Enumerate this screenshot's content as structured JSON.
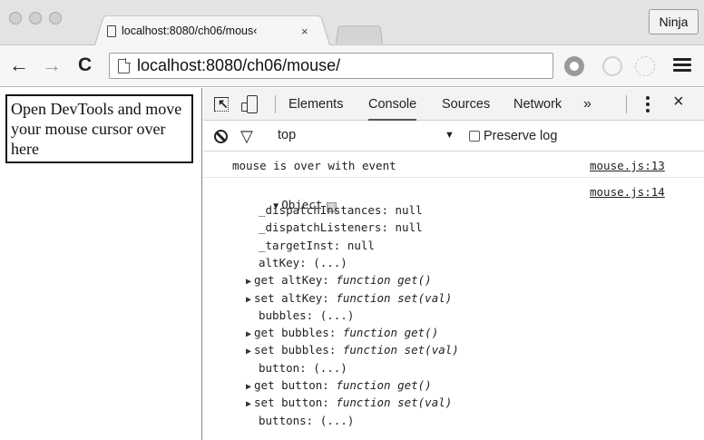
{
  "window": {
    "tab_title": "localhost:8080/ch06/mous‹",
    "tab_close": "×",
    "profile_label": "Ninja"
  },
  "toolbar": {
    "back": "←",
    "forward": "→",
    "reload": "C",
    "url": "localhost:8080/ch06/mouse/",
    "bookmark": "☆"
  },
  "page": {
    "mouse_box_text": "Open DevTools and move your mouse cursor over here"
  },
  "devtools": {
    "tabs": [
      "Elements",
      "Console",
      "Sources",
      "Network",
      "»"
    ],
    "active_tab": "Console",
    "close": "×",
    "filter": {
      "context": "top",
      "context_arrow": "▼",
      "preserve_log": "Preserve log"
    },
    "console": {
      "message": "mouse is over with event",
      "message_source": "mouse.js:13",
      "object_label": "Object",
      "object_source": "mouse.js:14",
      "properties": [
        {
          "text": "_dispatchInstances: null",
          "expandable": false
        },
        {
          "text": "_dispatchListeners: null",
          "expandable": false
        },
        {
          "text": "_targetInst: null",
          "expandable": false
        },
        {
          "text": "altKey: (...)",
          "expandable": false
        },
        {
          "prefix": "get altKey: ",
          "fn": "function get()",
          "expandable": true
        },
        {
          "prefix": "set altKey: ",
          "fn": "function set(val)",
          "expandable": true
        },
        {
          "text": "bubbles: (...)",
          "expandable": false
        },
        {
          "prefix": "get bubbles: ",
          "fn": "function get()",
          "expandable": true
        },
        {
          "prefix": "set bubbles: ",
          "fn": "function set(val)",
          "expandable": true
        },
        {
          "text": "button: (...)",
          "expandable": false
        },
        {
          "prefix": "get button: ",
          "fn": "function get()",
          "expandable": true
        },
        {
          "prefix": "set button: ",
          "fn": "function set(val)",
          "expandable": true
        },
        {
          "text": "buttons: (...)",
          "expandable": false
        }
      ]
    }
  }
}
